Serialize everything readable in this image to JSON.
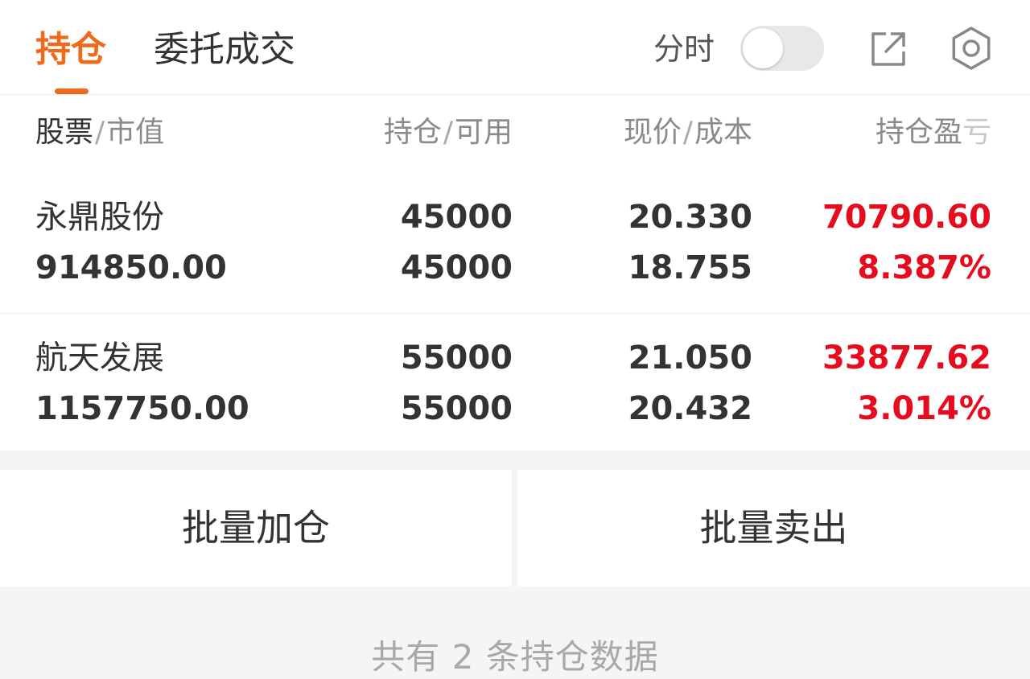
{
  "tabs": {
    "holdings": "持仓",
    "orders": "委托成交"
  },
  "header": {
    "fenshi_label": "分时",
    "fenshi_toggle_on": false,
    "icons": [
      "export-icon",
      "gear-icon"
    ]
  },
  "table": {
    "headers": {
      "stock": "股票",
      "market_value": "市值",
      "position": "持仓",
      "available": "可用",
      "price": "现价",
      "cost": "成本",
      "pl_part1": "持仓盈",
      "pl_part2": "亏"
    },
    "rows": [
      {
        "name": "永鼎股份",
        "market_value": "914850.00",
        "position": "45000",
        "available": "45000",
        "price": "20.330",
        "cost": "18.755",
        "pl": "70790.60",
        "pl_pct": "8.387%"
      },
      {
        "name": "航天发展",
        "market_value": "1157750.00",
        "position": "55000",
        "available": "55000",
        "price": "21.050",
        "cost": "20.432",
        "pl": "33877.62",
        "pl_pct": "3.014%"
      }
    ]
  },
  "actions": {
    "batch_add": "批量加仓",
    "batch_sell": "批量卖出"
  },
  "footer": {
    "summary": "共有 2 条持仓数据"
  },
  "colors": {
    "accent": "#f06a1c",
    "profit": "#e60c1e"
  }
}
